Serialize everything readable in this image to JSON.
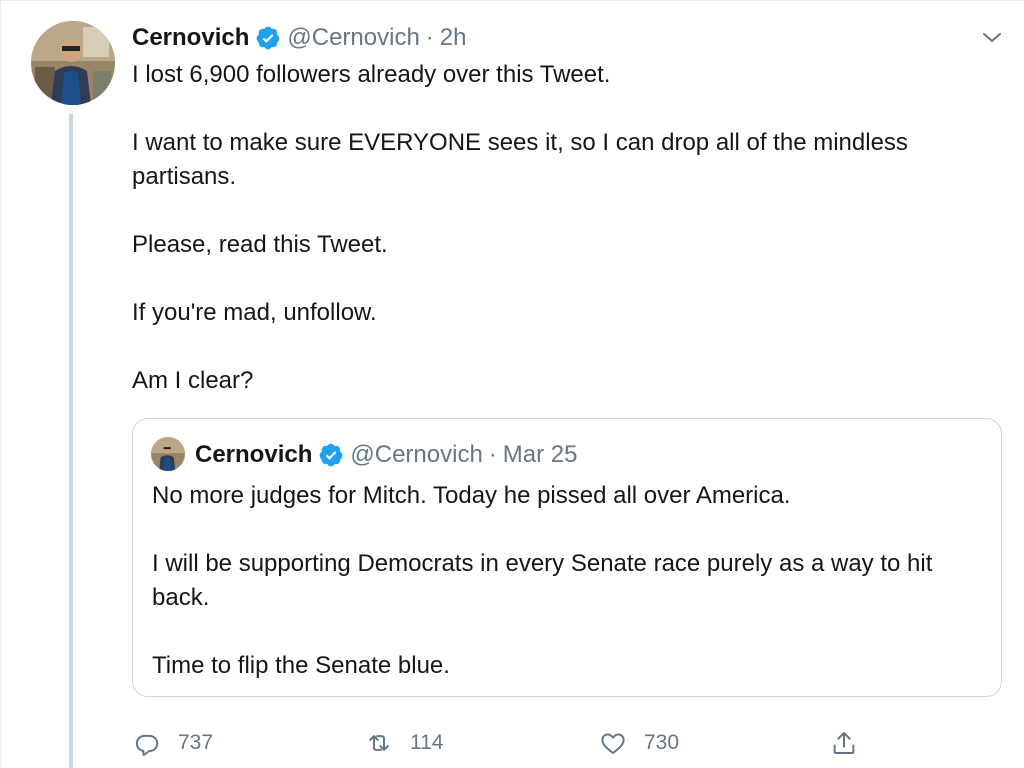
{
  "tweet": {
    "author_name": "Cernovich",
    "handle": "@Cernovich",
    "separator": "·",
    "timestamp": "2h",
    "lines": [
      "I lost 6,900 followers already over this Tweet.",
      "",
      "I want to make sure EVERYONE sees it, so I can drop all of the mindless partisans.",
      "",
      "Please, read this Tweet.",
      "",
      "If you're mad, unfollow.",
      "",
      "Am I clear?"
    ]
  },
  "quoted_tweet": {
    "author_name": "Cernovich",
    "handle": "@Cernovich",
    "separator": "·",
    "timestamp": "Mar 25",
    "lines": [
      "No more judges for Mitch. Today he pissed all over America.",
      "",
      "I will be supporting Democrats in every Senate race purely as a way to hit back.",
      "",
      "Time to flip the Senate blue."
    ]
  },
  "actions": {
    "reply_count": "737",
    "retweet_count": "114",
    "like_count": "730"
  },
  "icons": {
    "verified": "verified-badge-icon",
    "caret": "chevron-down-icon",
    "reply": "reply-bubble-icon",
    "retweet": "retweet-arrows-icon",
    "like": "heart-icon",
    "share": "share-upload-icon"
  },
  "colors": {
    "accent": "#1da1f2",
    "text": "#14171a",
    "secondary_text": "#657786",
    "border": "#ccd6dd"
  }
}
